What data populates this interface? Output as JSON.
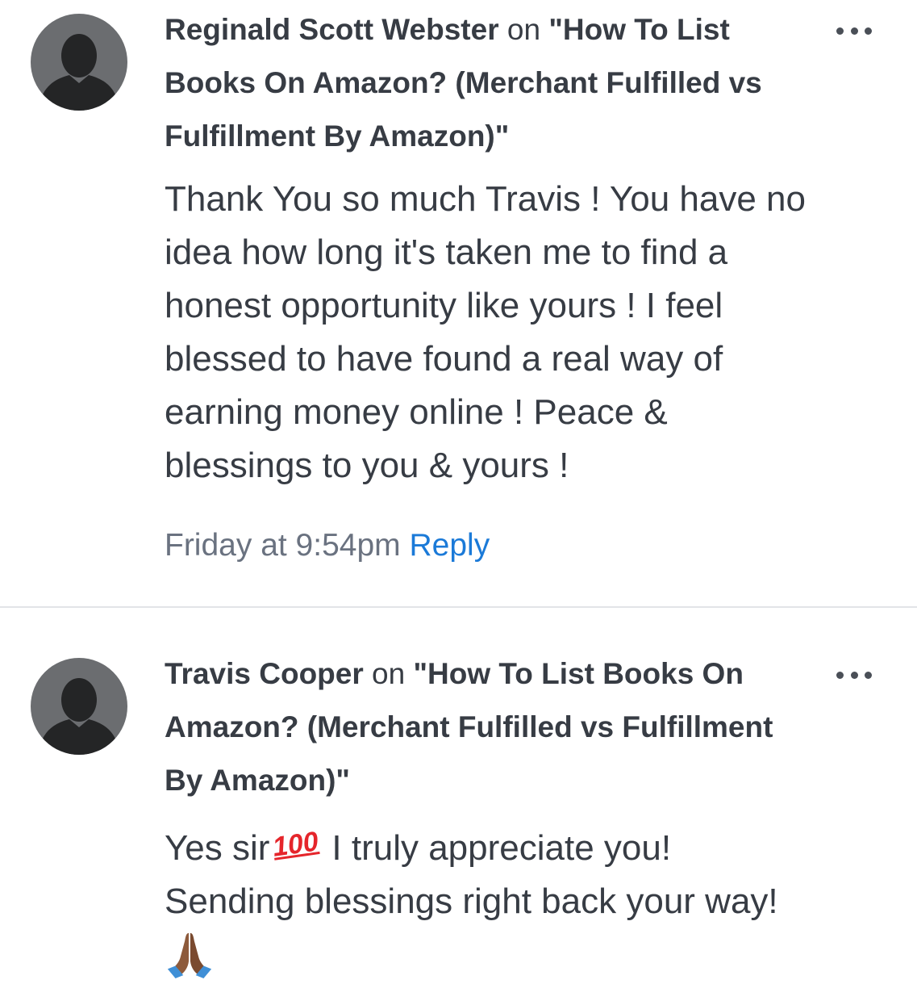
{
  "comments": [
    {
      "author": "Reginald Scott Webster",
      "on_word": "on",
      "post_title_quoted": "\"How To List Books On Amazon? (Merchant Fulfilled vs Fulfillment By Amazon)\"",
      "text": "Thank You so much Travis ! You have no idea how long it's taken me to find a honest opportunity like yours ! I feel blessed to have found a real way of earning money online ! Peace & blessings to you & yours !",
      "timestamp": "Friday at 9:54pm",
      "reply_label": "Reply"
    },
    {
      "author": "Travis Cooper",
      "on_word": "on",
      "post_title_quoted": "\"How To List Books On Amazon? (Merchant Fulfilled vs Fulfillment By Amazon)\"",
      "text_part1": "Yes sir",
      "emoji_100": "100",
      "text_part2": " I truly appreciate you! Sending blessings right back your way!",
      "emoji_pray": "folded-hands-emoji"
    }
  ],
  "icons": {
    "avatar": "default-user-avatar-icon",
    "more": "more-options-icon"
  },
  "colors": {
    "text": "#373c44",
    "timestamp": "#6a7280",
    "link": "#1b7ad8",
    "avatar_bg": "#6b6d70",
    "divider": "#e2e4e7"
  }
}
